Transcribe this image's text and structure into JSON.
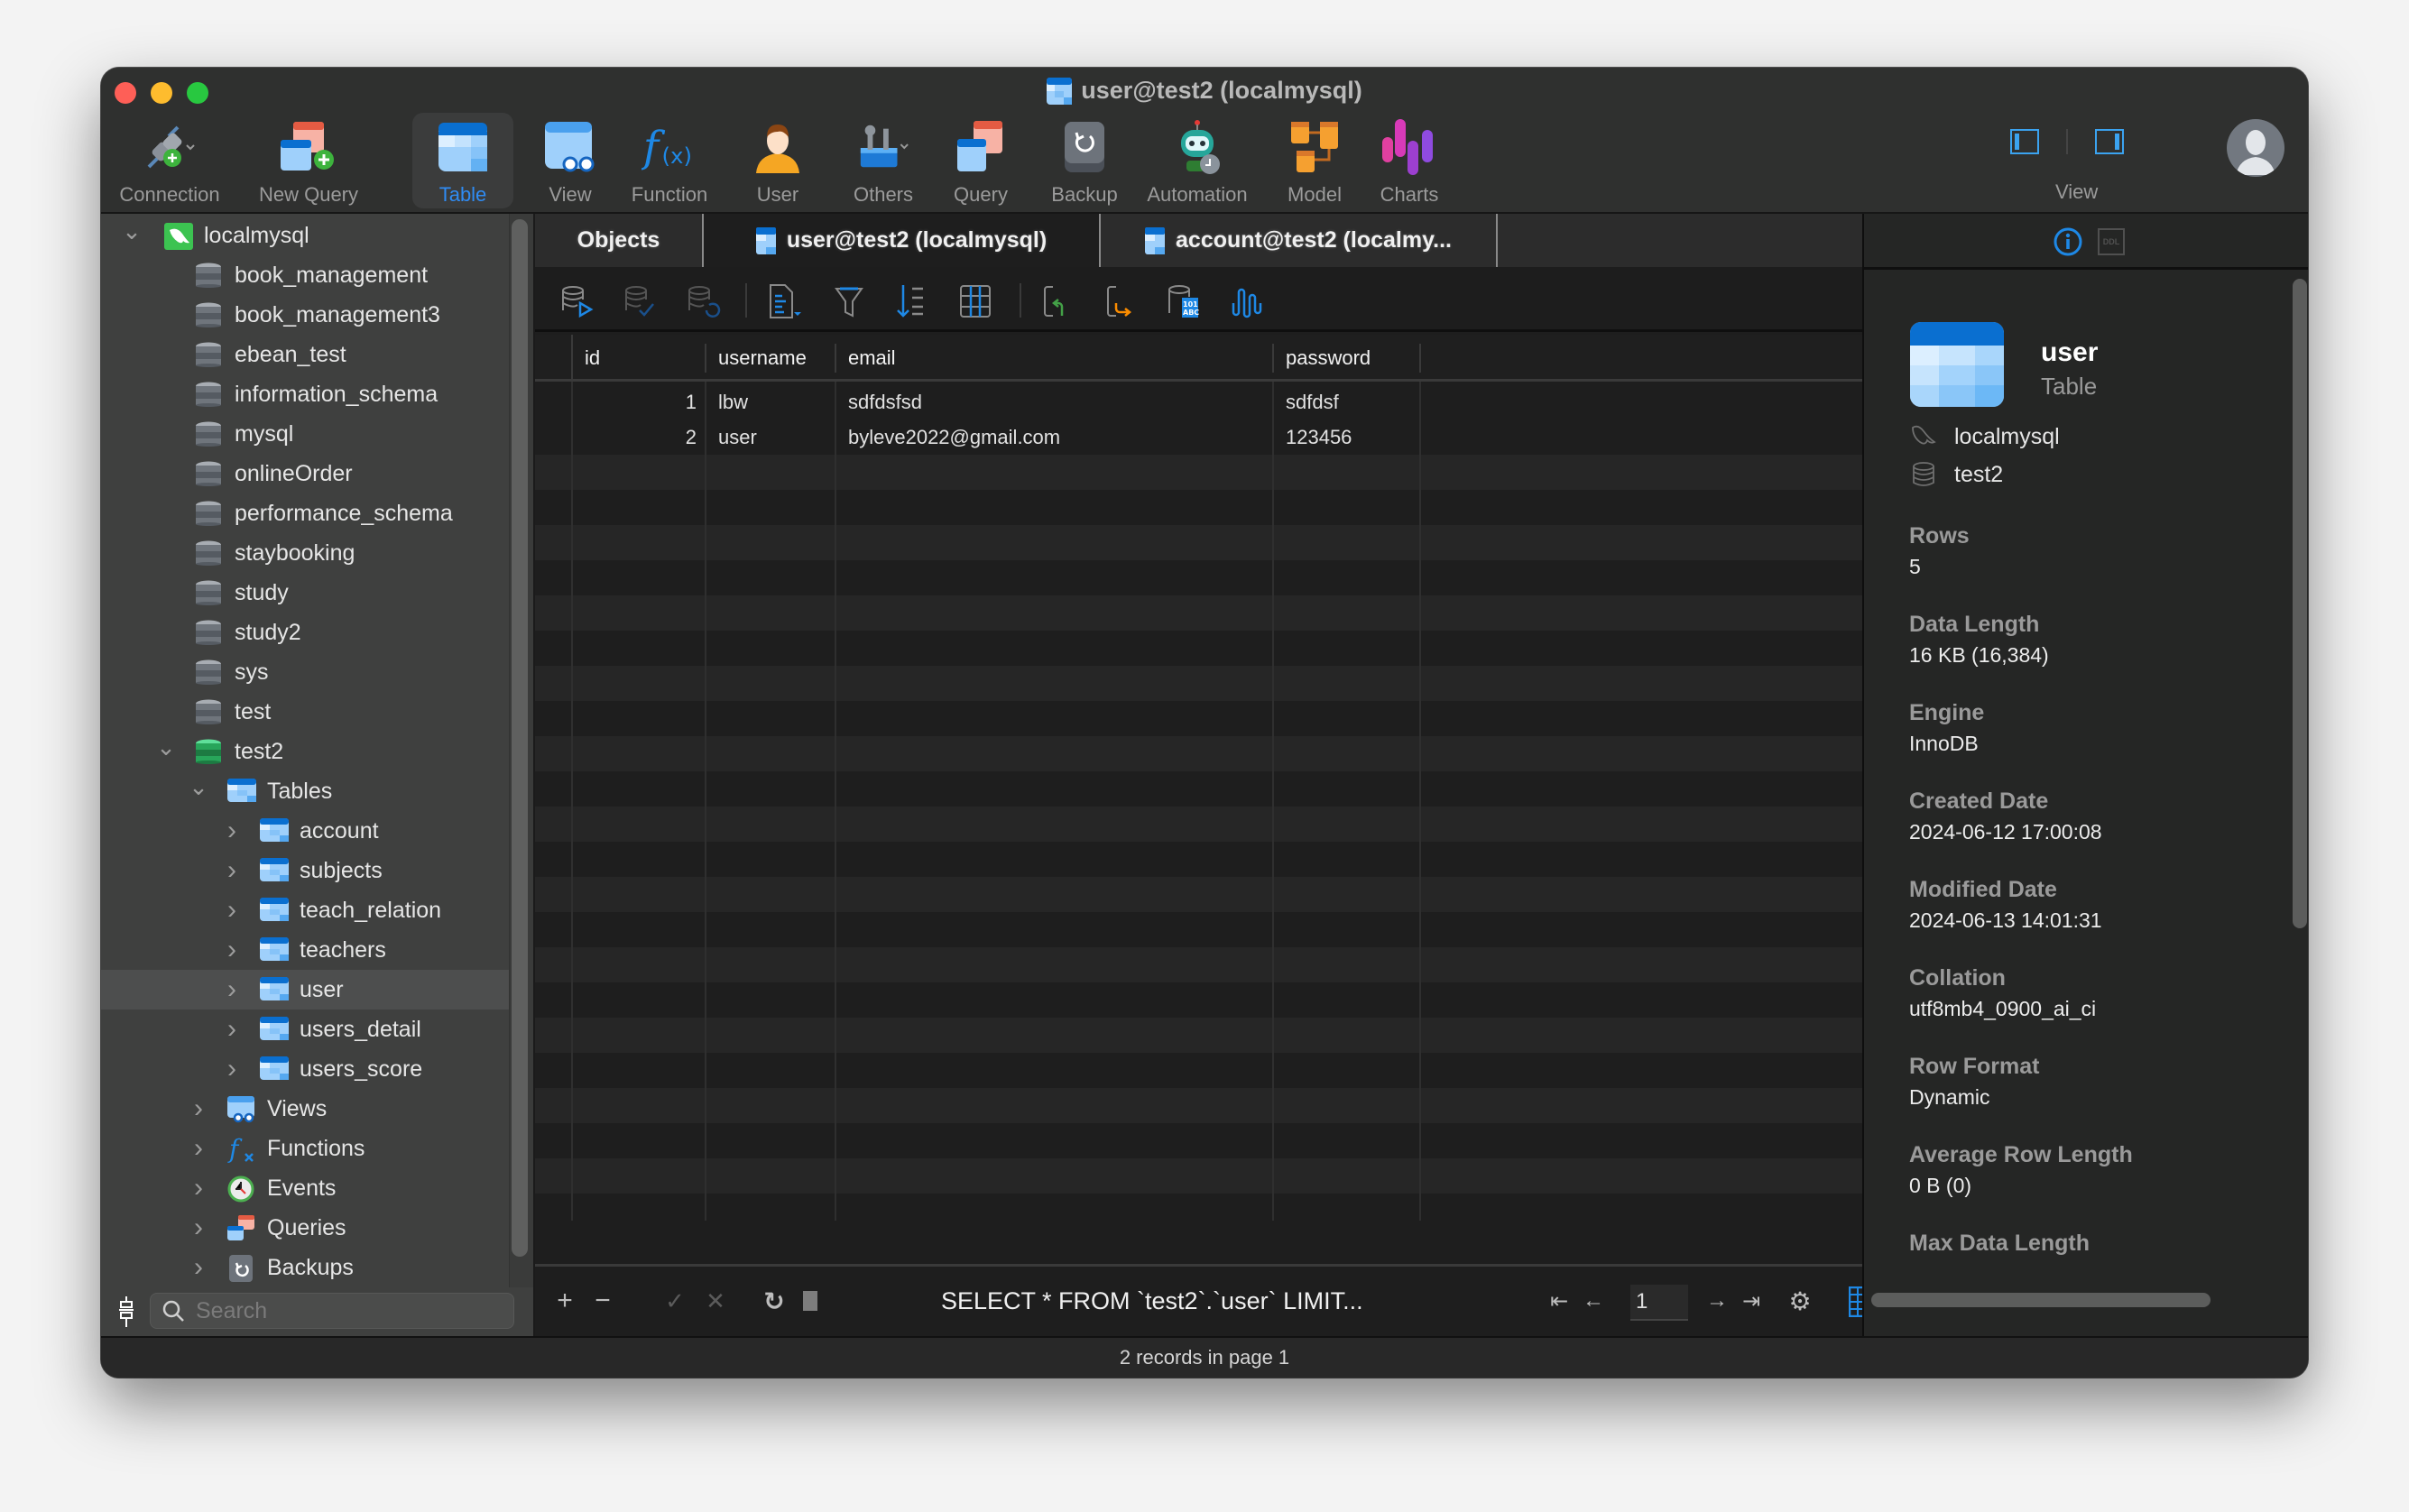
{
  "window": {
    "title": "user@test2 (localmysql)"
  },
  "toolbar": {
    "items": [
      {
        "label": "Connection",
        "icon": "plug-add-icon"
      },
      {
        "label": "New Query",
        "icon": "new-query-icon"
      },
      {
        "label": "Table",
        "icon": "table-icon",
        "active": true
      },
      {
        "label": "View",
        "icon": "view-icon"
      },
      {
        "label": "Function",
        "icon": "function-icon"
      },
      {
        "label": "User",
        "icon": "user-icon"
      },
      {
        "label": "Others",
        "icon": "tools-icon"
      },
      {
        "label": "Query",
        "icon": "query-icon"
      },
      {
        "label": "Backup",
        "icon": "backup-icon"
      },
      {
        "label": "Automation",
        "icon": "robot-icon"
      },
      {
        "label": "Model",
        "icon": "model-icon"
      },
      {
        "label": "Charts",
        "icon": "charts-icon"
      }
    ],
    "view_label": "View",
    "accent": "#2f8cf4"
  },
  "sidebar": {
    "connection": "localmysql",
    "databases": [
      "book_management",
      "book_management3",
      "ebean_test",
      "information_schema",
      "mysql",
      "onlineOrder",
      "performance_schema",
      "staybooking",
      "study",
      "study2",
      "sys",
      "test"
    ],
    "open_database": "test2",
    "tables_label": "Tables",
    "tables": [
      "account",
      "subjects",
      "teach_relation",
      "teachers",
      "user",
      "users_detail",
      "users_score"
    ],
    "selected_table": "user",
    "groups": [
      "Views",
      "Functions",
      "Events",
      "Queries",
      "Backups"
    ],
    "search_placeholder": "Search"
  },
  "tabs": [
    {
      "label": "Objects"
    },
    {
      "label": "user@test2 (localmysql)",
      "active": true
    },
    {
      "label": "account@test2 (localmy..."
    }
  ],
  "grid": {
    "columns": [
      "id",
      "username",
      "email",
      "password"
    ],
    "rows": [
      [
        "1",
        "lbw",
        "sdfdsfsd",
        "sdfdsf"
      ],
      [
        "2",
        "user",
        "byleve2022@gmail.com",
        "123456"
      ]
    ]
  },
  "bottom_bar": {
    "sql": "SELECT * FROM `test2`.`user` LIMIT...",
    "page": "1"
  },
  "status": "2 records in page 1",
  "info_panel": {
    "name": "user",
    "type": "Table",
    "connection": "localmysql",
    "database": "test2",
    "ddl_label": "DDL",
    "fields": [
      {
        "label": "Rows",
        "value": "5"
      },
      {
        "label": "Data Length",
        "value": "16 KB (16,384)"
      },
      {
        "label": "Engine",
        "value": "InnoDB"
      },
      {
        "label": "Created Date",
        "value": "2024-06-12 17:00:08"
      },
      {
        "label": "Modified Date",
        "value": "2024-06-13 14:01:31"
      },
      {
        "label": "Collation",
        "value": "utf8mb4_0900_ai_ci"
      },
      {
        "label": "Row Format",
        "value": "Dynamic"
      },
      {
        "label": "Average Row Length",
        "value": "0 B (0)"
      },
      {
        "label": "Max Data Length",
        "value": ""
      }
    ]
  }
}
